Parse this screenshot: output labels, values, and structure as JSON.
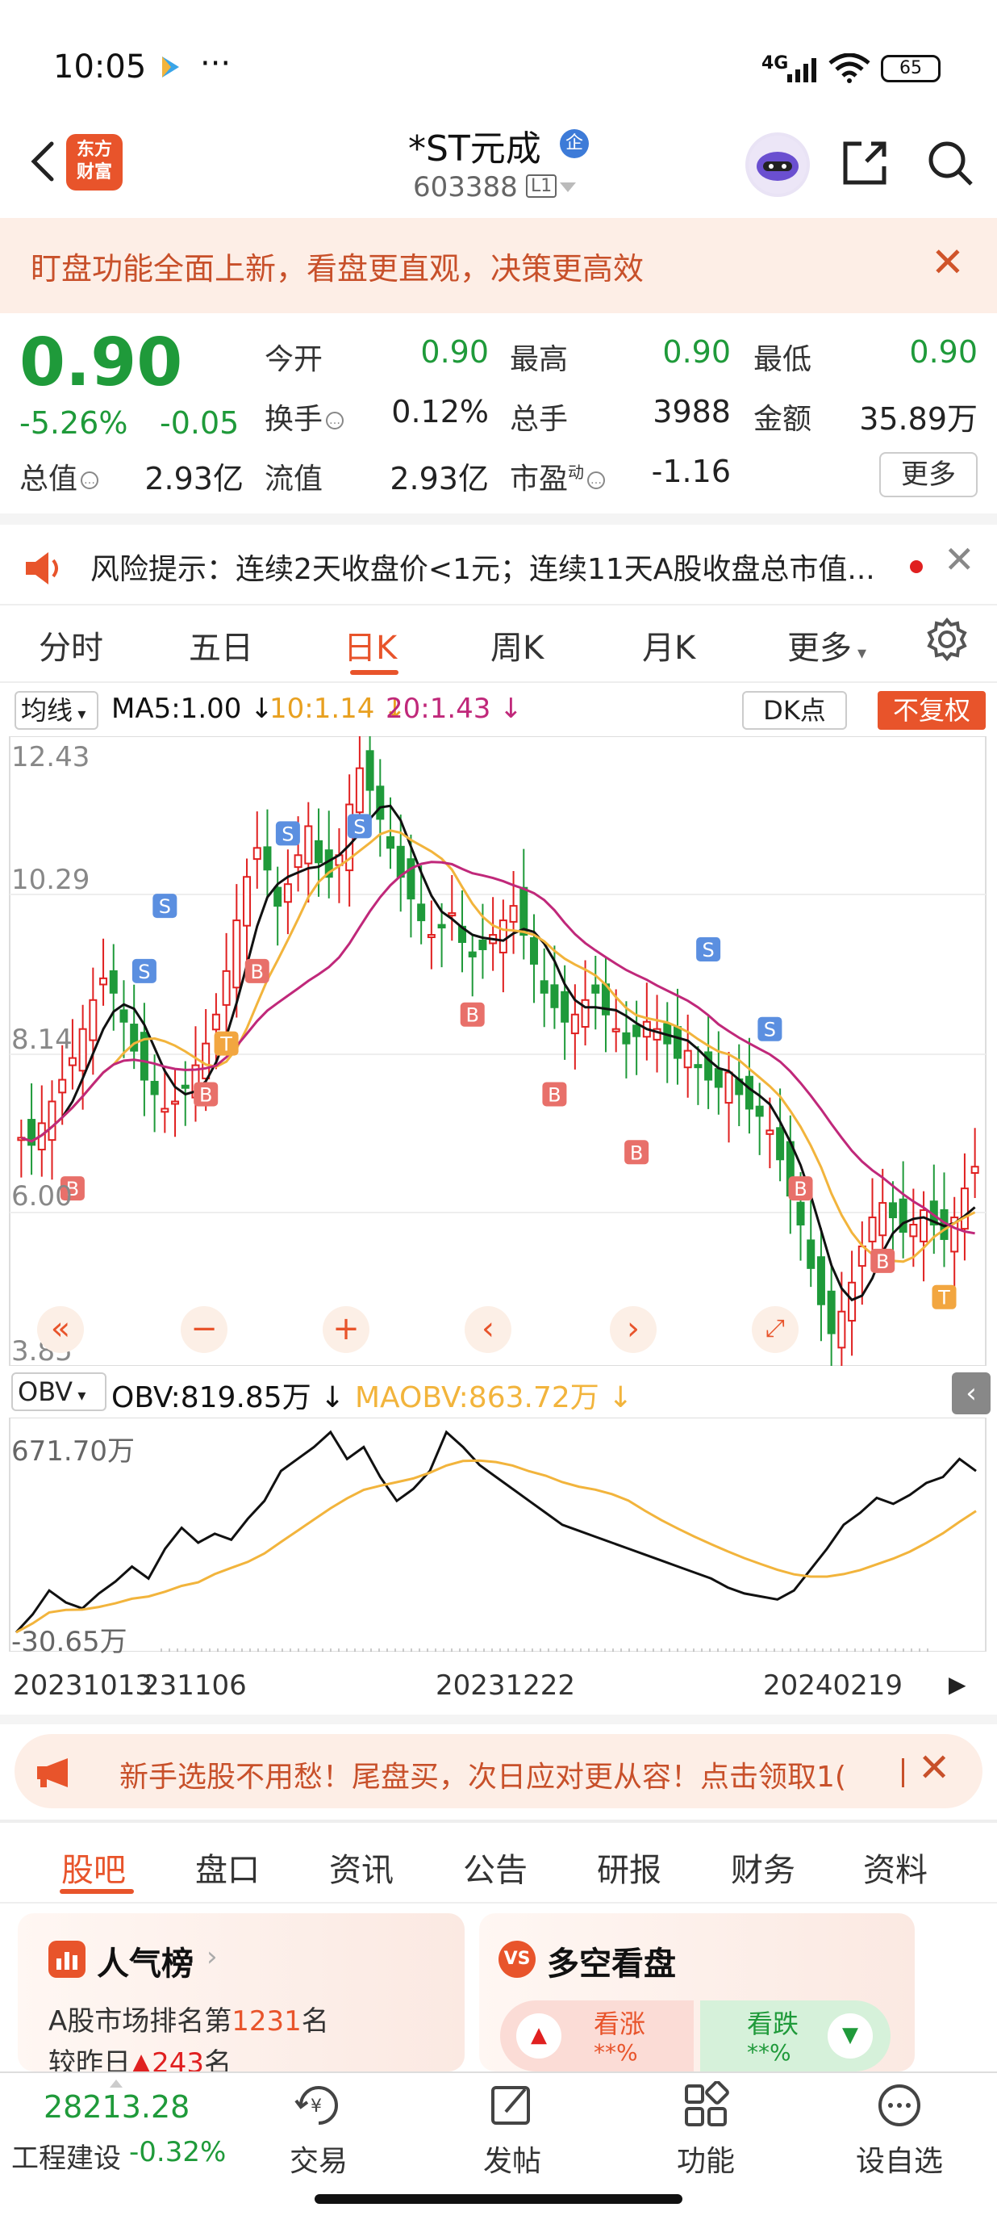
{
  "status_bar": {
    "time": "10:05",
    "dots": "···",
    "signal": "4G",
    "battery": "65"
  },
  "header": {
    "back": "back",
    "logo_text": "东方\n财富",
    "stock_name": "*ST元成",
    "badge": "企",
    "stock_code": "603388",
    "level": "L1"
  },
  "banner_top": {
    "text": "盯盘功能全面上新，看盘更直观，决策更高效"
  },
  "quote": {
    "price": "0.90",
    "change_pct": "-5.26%",
    "change": "-0.05",
    "today_open_label": "今开",
    "today_open": "0.90",
    "high_label": "最高",
    "high": "0.90",
    "low_label": "最低",
    "low": "0.90",
    "turnover_label": "换手",
    "turnover": "0.12%",
    "volume_label": "总手",
    "volume": "3988",
    "amount_label": "金额",
    "amount": "35.89万",
    "total_cap_label": "总值",
    "total_cap": "2.93亿",
    "float_cap_label": "流值",
    "float_cap": "2.93亿",
    "pe_label": "市盈",
    "pe_sup": "动",
    "pe": "-1.16",
    "more": "更多"
  },
  "risk": {
    "text": "风险提示：连续2天收盘价<1元；连续11天A股收盘总市值..."
  },
  "period_tabs": [
    "分时",
    "五日",
    "日K",
    "周K",
    "月K",
    "更多"
  ],
  "ma_bar": {
    "selector": "均线",
    "ma5": "MA5:1.00",
    "ma10": "10:1.14",
    "ma20": "20:1.43",
    "dk": "DK点",
    "adjust": "不复权"
  },
  "kchart": {
    "y_labels": [
      "12.43",
      "10.29",
      "8.14",
      "6.00",
      "3.85"
    ]
  },
  "obv_bar": {
    "selector": "OBV",
    "obv": "OBV:819.85万",
    "maobv": "MAOBV:863.72万"
  },
  "obv_chart": {
    "top": "671.70万",
    "bottom": "-30.65万"
  },
  "dates": [
    "20231013",
    "231106",
    "20231222",
    "20240219"
  ],
  "banner_bottom": {
    "text": "新手选股不用愁！尾盘买，次日应对更从容！点击领取1("
  },
  "bottom_tabs": [
    "股吧",
    "盘口",
    "资讯",
    "公告",
    "研报",
    "财务",
    "资料"
  ],
  "cards": {
    "popularity": {
      "title": "人气榜",
      "rank_text": "A股市场排名第",
      "rank": "1231",
      "rank_unit": "名",
      "prev_text": "较昨日",
      "prev_change": "243",
      "prev_unit": "名"
    },
    "bull_bear": {
      "title": "多空看盘",
      "up_label": "看涨",
      "up_val": "**%",
      "down_label": "看跌",
      "down_val": "**%"
    }
  },
  "bottom_nav": {
    "index_value": "28213.28",
    "index_name": "工程建设",
    "index_change": "-0.32%",
    "items": [
      "交易",
      "发帖",
      "功能",
      "设自选"
    ]
  },
  "colors": {
    "accent": "#e8542b",
    "green": "#1f9a3a",
    "ma5": "#111111",
    "ma10": "#f2b43c",
    "ma20": "#c0287a"
  }
}
